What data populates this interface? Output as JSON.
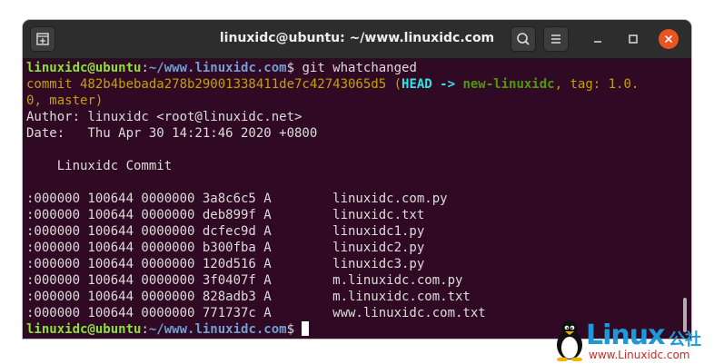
{
  "window": {
    "title": "linuxidc@ubuntu: ~/www.linuxidc.com"
  },
  "terminal": {
    "prompt_user": "linuxidc@ubuntu",
    "prompt_sep": ":",
    "prompt_path": "~/www.linuxidc.com",
    "prompt_symbol": "$",
    "command": " git whatchanged",
    "commit_prefix": "commit 482b4bebada278b29001338411de7c42743065d5 ",
    "commit_paren_open": "(",
    "commit_head": "HEAD -> ",
    "commit_branch": "new-linuxidc",
    "commit_tag_1": ", tag: 1.0.",
    "commit_tag_2": "0",
    "commit_master": ", master",
    "commit_paren_close": ")",
    "author_line": "Author: linuxidc <root@linuxidc.net>",
    "date_line": "Date:   Thu Apr 30 14:21:46 2020 +0800",
    "message_line": "    Linuxidc Commit",
    "changes": [
      ":000000 100644 0000000 3a8c6c5 A        linuxidc.com.py",
      ":000000 100644 0000000 deb899f A        linuxidc.txt",
      ":000000 100644 0000000 dcfec9d A        linuxidc1.py",
      ":000000 100644 0000000 b300fba A        linuxidc2.py",
      ":000000 100644 0000000 120d516 A        linuxidc3.py",
      ":000000 100644 0000000 3f0407f A        m.linuxidc.com.py",
      ":000000 100644 0000000 828adb3 A        m.linuxidc.com.txt",
      ":000000 100644 0000000 771737c A        www.linuxidc.com.txt"
    ]
  },
  "watermark": {
    "logo_text": "Linux",
    "logo_cn": "公社",
    "url": "www.Linuxidc.com"
  },
  "colors": {
    "terminal_bg": "#300a24",
    "prompt_user": "#8ae234",
    "prompt_path": "#729fcf",
    "commit": "#c4a000",
    "head": "#34e2e2",
    "branch": "#4e9a06",
    "close_button": "#e95420"
  },
  "icons": [
    "new-tab-icon",
    "search-icon",
    "hamburger-menu-icon",
    "minimize-icon",
    "maximize-icon",
    "close-icon",
    "tux-penguin-icon"
  ]
}
